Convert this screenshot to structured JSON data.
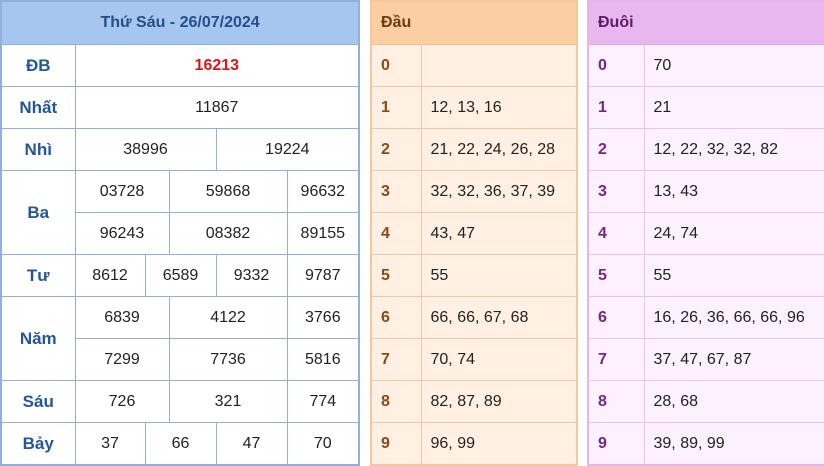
{
  "results": {
    "date_title": "Thứ Sáu - 26/07/2024",
    "rows": {
      "db": {
        "label": "ĐB",
        "values": [
          "16213"
        ]
      },
      "nhat": {
        "label": "Nhất",
        "values": [
          "11867"
        ]
      },
      "nhi": {
        "label": "Nhì",
        "values": [
          "38996",
          "19224"
        ]
      },
      "ba": {
        "label": "Ba",
        "values": [
          "03728",
          "59868",
          "96632",
          "96243",
          "08382",
          "89155"
        ]
      },
      "tu": {
        "label": "Tư",
        "values": [
          "8612",
          "6589",
          "9332",
          "9787"
        ]
      },
      "nam": {
        "label": "Năm",
        "values": [
          "6839",
          "4122",
          "3766",
          "7299",
          "7736",
          "5816"
        ]
      },
      "sau": {
        "label": "Sáu",
        "values": [
          "726",
          "321",
          "774"
        ]
      },
      "bay": {
        "label": "Bảy",
        "values": [
          "37",
          "66",
          "47",
          "70"
        ]
      }
    }
  },
  "dau": {
    "header": "Đầu",
    "rows": [
      {
        "k": "0",
        "v": ""
      },
      {
        "k": "1",
        "v": "12, 13, 16"
      },
      {
        "k": "2",
        "v": "21, 22, 24, 26, 28"
      },
      {
        "k": "3",
        "v": "32, 32, 36, 37, 39"
      },
      {
        "k": "4",
        "v": "43, 47"
      },
      {
        "k": "5",
        "v": "55"
      },
      {
        "k": "6",
        "v": "66, 66, 67, 68"
      },
      {
        "k": "7",
        "v": "70, 74"
      },
      {
        "k": "8",
        "v": "82, 87, 89"
      },
      {
        "k": "9",
        "v": "96, 99"
      }
    ]
  },
  "duoi": {
    "header": "Đuôi",
    "rows": [
      {
        "k": "0",
        "v": "70"
      },
      {
        "k": "1",
        "v": "21"
      },
      {
        "k": "2",
        "v": "12, 22, 32, 32, 82"
      },
      {
        "k": "3",
        "v": "13, 43"
      },
      {
        "k": "4",
        "v": "24, 74"
      },
      {
        "k": "5",
        "v": "55"
      },
      {
        "k": "6",
        "v": "16, 26, 36, 66, 66, 96"
      },
      {
        "k": "7",
        "v": "37, 47, 67, 87"
      },
      {
        "k": "8",
        "v": "28, 68"
      },
      {
        "k": "9",
        "v": "39, 89, 99"
      }
    ]
  }
}
